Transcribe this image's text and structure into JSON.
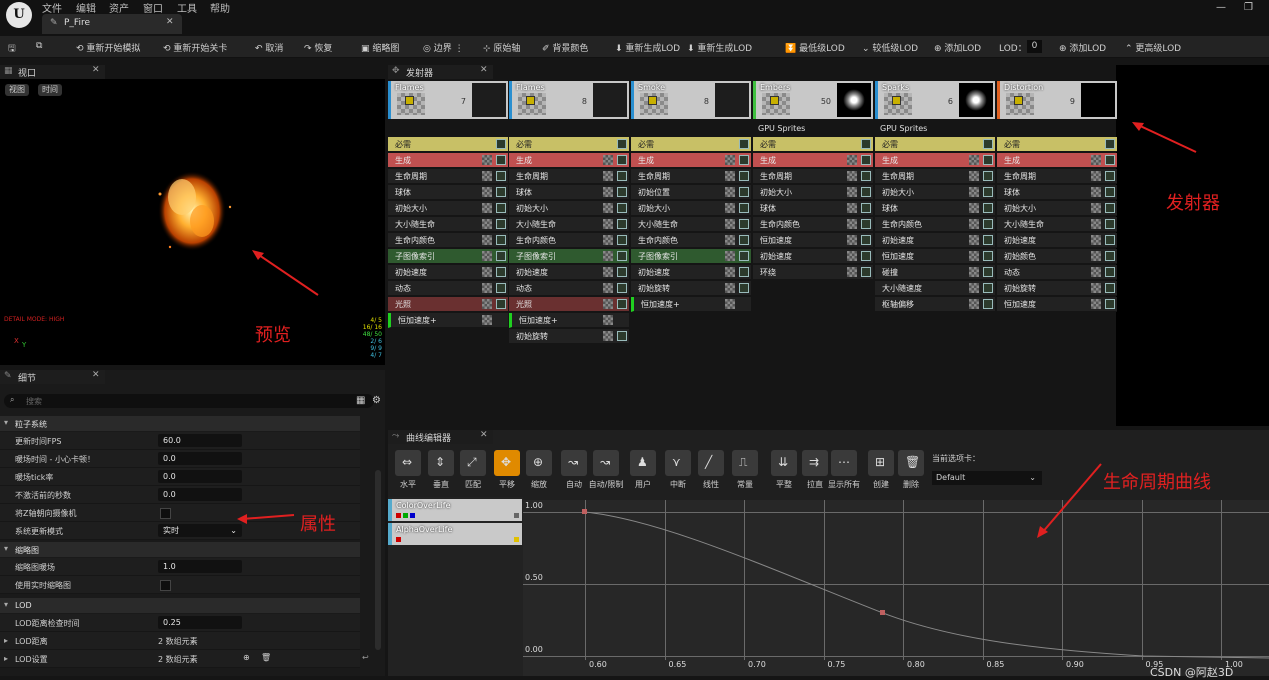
{
  "menu": {
    "file": "文件",
    "edit": "编辑",
    "asset": "资产",
    "window": "窗口",
    "tools": "工具",
    "help": "帮助"
  },
  "tab": {
    "title": "P_Fire"
  },
  "toolbar": {
    "restart_sim": "重新开始模拟",
    "restart_level": "重新开始关卡",
    "undo": "取消",
    "redo": "恢复",
    "thumbnail": "缩略图",
    "bounds": "边界",
    "origin_axis": "原始轴",
    "bg_color": "背景颜色",
    "regen_lod1": "重新生成LOD",
    "regen_lod2": "重新生成LOD",
    "lowest_lod": "最低级LOD",
    "lower_lod": "较低级LOD",
    "add_lod1": "添加LOD",
    "lod_label": "LOD：",
    "lod_value": "0",
    "add_lod2": "添加LOD",
    "higher_lod": "更高级LOD"
  },
  "viewport": {
    "title": "视口",
    "view_btn": "视图",
    "time_btn": "时间",
    "detail_mode": "DETAIL MODE: HIGH",
    "axis_x": "X",
    "axis_y": "Y",
    "annotation": "预览",
    "stats": [
      "4/ 5",
      "16/ 16",
      "48/ 50",
      "2/ 6",
      "9/ 9",
      "4/ 7"
    ]
  },
  "emitters": {
    "title": "发射器",
    "annotation": "发射器",
    "columns": [
      {
        "name": "Flames",
        "count": "7",
        "sub": "",
        "modules": [
          [
            "必需",
            "req"
          ],
          [
            "生成",
            "spawn"
          ],
          [
            "生命周期",
            ""
          ],
          [
            "球体",
            ""
          ],
          [
            "初始大小",
            ""
          ],
          [
            "大小随生命",
            ""
          ],
          [
            "生命内颜色",
            ""
          ],
          [
            "子图像索引",
            "green"
          ],
          [
            "初始速度",
            ""
          ],
          [
            "动态",
            ""
          ],
          [
            "光照",
            "light"
          ],
          [
            "恒加速度+",
            "sel"
          ]
        ]
      },
      {
        "name": "Flames",
        "count": "8",
        "sub": "",
        "modules": [
          [
            "必需",
            "req"
          ],
          [
            "生成",
            "spawn"
          ],
          [
            "生命周期",
            ""
          ],
          [
            "球体",
            ""
          ],
          [
            "初始大小",
            ""
          ],
          [
            "大小随生命",
            ""
          ],
          [
            "生命内颜色",
            ""
          ],
          [
            "子图像索引",
            "green"
          ],
          [
            "初始速度",
            ""
          ],
          [
            "动态",
            ""
          ],
          [
            "光照",
            "light"
          ],
          [
            "恒加速度+",
            "sel"
          ],
          [
            "初始旋转",
            ""
          ]
        ]
      },
      {
        "name": "Smoke",
        "count": "8",
        "sub": "",
        "modules": [
          [
            "必需",
            "req"
          ],
          [
            "生成",
            "spawn"
          ],
          [
            "生命周期",
            ""
          ],
          [
            "初始位置",
            ""
          ],
          [
            "初始大小",
            ""
          ],
          [
            "大小随生命",
            ""
          ],
          [
            "生命内颜色",
            ""
          ],
          [
            "子图像索引",
            "green"
          ],
          [
            "初始速度",
            ""
          ],
          [
            "初始旋转",
            ""
          ],
          [
            "恒加速度+",
            "sel"
          ]
        ]
      },
      {
        "name": "Embers",
        "count": "50",
        "sub": "GPU Sprites",
        "modules": [
          [
            "必需",
            "req"
          ],
          [
            "生成",
            "spawn"
          ],
          [
            "生命周期",
            ""
          ],
          [
            "初始大小",
            ""
          ],
          [
            "球体",
            ""
          ],
          [
            "生命内颜色",
            ""
          ],
          [
            "恒加速度",
            ""
          ],
          [
            "初始速度",
            ""
          ],
          [
            "环绕",
            ""
          ]
        ]
      },
      {
        "name": "Sparks",
        "count": "6",
        "sub": "GPU Sprites",
        "modules": [
          [
            "必需",
            "req"
          ],
          [
            "生成",
            "spawn"
          ],
          [
            "生命周期",
            ""
          ],
          [
            "初始大小",
            ""
          ],
          [
            "球体",
            ""
          ],
          [
            "生命内颜色",
            ""
          ],
          [
            "初始速度",
            ""
          ],
          [
            "恒加速度",
            ""
          ],
          [
            "碰撞",
            ""
          ],
          [
            "大小随速度",
            ""
          ],
          [
            "枢轴偏移",
            ""
          ]
        ]
      },
      {
        "name": "Distortion",
        "count": "9",
        "sub": "",
        "modules": [
          [
            "必需",
            "req"
          ],
          [
            "生成",
            "spawn"
          ],
          [
            "生命周期",
            ""
          ],
          [
            "球体",
            ""
          ],
          [
            "初始大小",
            ""
          ],
          [
            "大小随生命",
            ""
          ],
          [
            "初始速度",
            ""
          ],
          [
            "初始颜色",
            ""
          ],
          [
            "动态",
            ""
          ],
          [
            "初始旋转",
            ""
          ],
          [
            "恒加速度",
            ""
          ]
        ]
      }
    ]
  },
  "details": {
    "title": "细节",
    "search_placeholder": "搜索",
    "annotation": "属性",
    "cat_particle": "粒子系统",
    "cat_thumb": "缩略图",
    "cat_lod": "LOD",
    "p_fps": "更新时间FPS",
    "v_fps": "60.0",
    "p_warmup": "暖场时间 - 小心卡顿！",
    "v_warmup": "0.0",
    "p_tick": "暖场tick率",
    "v_tick": "0.0",
    "p_inactive": "不激活前的秒数",
    "v_inactive": "0.0",
    "p_orient": "将Z轴朝向摄像机",
    "p_update": "系统更新模式",
    "v_update": "实时",
    "p_thumbwarm": "缩略图暖场",
    "v_thumbwarm": "1.0",
    "p_realthumb": "使用实时缩略图",
    "p_lodcheck": "LOD距离检查时间",
    "v_lodcheck": "0.25",
    "p_loddist": "LOD距离",
    "v_loddist": "2 数组元素",
    "p_lodset": "LOD设置",
    "v_lodset": "2 数组元素"
  },
  "curve": {
    "title": "曲线编辑器",
    "annotation": "生命周期曲线",
    "tools": [
      "水平",
      "垂直",
      "匹配",
      "平移",
      "缩放",
      "自动",
      "自动/限制",
      "用户",
      "中断",
      "线性",
      "常量",
      "平整",
      "拉直",
      "显示所有",
      "创建",
      "删除"
    ],
    "current_tab_label": "当前选项卡：",
    "current_tab": "Default",
    "tracks": [
      "ColorOverLife",
      "AlphaOverLife"
    ],
    "yticks": [
      "1.00",
      "0.50",
      "0.00"
    ],
    "xticks": [
      "0.60",
      "0.65",
      "0.70",
      "0.75",
      "0.80",
      "0.85",
      "0.90",
      "0.95",
      "1.00"
    ],
    "watermark": "CSDN @阿赵3D"
  }
}
